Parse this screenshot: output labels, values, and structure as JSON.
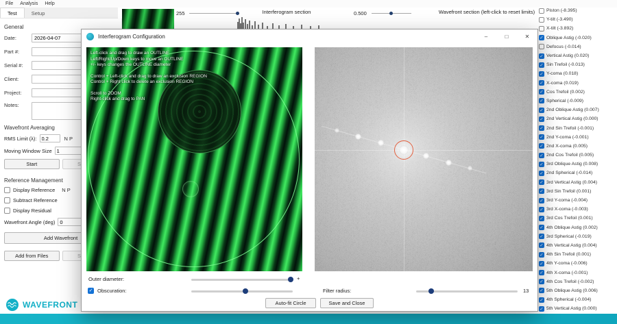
{
  "menu": {
    "items": [
      "File",
      "Analysis",
      "Help"
    ]
  },
  "tabs": [
    {
      "label": "Test"
    },
    {
      "label": "Setup"
    }
  ],
  "general": {
    "title": "General",
    "fields": [
      {
        "label": "Date:",
        "value": "2026-04-07"
      },
      {
        "label": "Part #:",
        "value": ""
      },
      {
        "label": "Serial #:",
        "value": ""
      },
      {
        "label": "Client:",
        "value": ""
      },
      {
        "label": "Project:",
        "value": ""
      },
      {
        "label": "Notes:",
        "value": "",
        "tall": true
      }
    ]
  },
  "averaging": {
    "title": "Wavefront Averaging",
    "rms_label": "RMS Limit (λ):",
    "rms_value": "0.2",
    "rms_suffix": "N P",
    "window_label": "Moving Window Size",
    "window_value": "1",
    "start_button": "Start",
    "save_button": "Save to Fil"
  },
  "reference": {
    "title": "Reference Management",
    "checkboxes": [
      {
        "label": "Display Reference",
        "checked": false,
        "suffix": "N P"
      },
      {
        "label": "Subtract Reference",
        "checked": false
      },
      {
        "label": "Display Residual",
        "checked": false
      }
    ],
    "angle_label": "Wavefront Angle (deg)",
    "angle_value": "0",
    "add_wavefront_button": "Add Wavefront",
    "add_from_files_button": "Add from Files",
    "save_button": "Save to Fil"
  },
  "sections_bar": {
    "interferogram_level": "255",
    "interferogram_title": "Interferogram section",
    "wavefront_level": "0.500",
    "wavefront_title": "Wavefront section (left-click to reset limits)"
  },
  "brand": {
    "name": "WAVEFRONT",
    "accent": "#13b0c7"
  },
  "zernike": {
    "items": [
      {
        "label": "Piston (-8.395)",
        "checked": false
      },
      {
        "label": "Y-tilt (-3.490)",
        "checked": false
      },
      {
        "label": "X-tilt (-3.892)",
        "checked": false
      },
      {
        "label": "Oblique Astig (-0.020)",
        "checked": true
      },
      {
        "label": "Defocus (-0.014)",
        "checked": false
      },
      {
        "label": "Vertical Astig (0.020)",
        "checked": true
      },
      {
        "label": "Sin Trefoil (-0.013)",
        "checked": true
      },
      {
        "label": "Y-coma (0.018)",
        "checked": true
      },
      {
        "label": "X-coma (0.019)",
        "checked": true
      },
      {
        "label": "Cos Trefoil (0.002)",
        "checked": true
      },
      {
        "label": "Spherical (-0.009)",
        "checked": true
      },
      {
        "label": "2nd Oblique Astig (0.007)",
        "checked": true
      },
      {
        "label": "2nd Vertical Astig (0.000)",
        "checked": true
      },
      {
        "label": "2nd Sin Trefoil (-0.001)",
        "checked": true
      },
      {
        "label": "2nd Y-coma (-0.001)",
        "checked": true
      },
      {
        "label": "2nd X-coma (0.005)",
        "checked": true
      },
      {
        "label": "2nd Cos Trefoil (0.005)",
        "checked": true
      },
      {
        "label": "3rd Oblique Astig (0.008)",
        "checked": true
      },
      {
        "label": "2nd Spherical (-0.014)",
        "checked": true
      },
      {
        "label": "3rd Vertical Astig (0.004)",
        "checked": true
      },
      {
        "label": "3rd Sin Trefoil (0.001)",
        "checked": true
      },
      {
        "label": "3rd Y-coma (-0.004)",
        "checked": true
      },
      {
        "label": "3rd X-coma (-0.003)",
        "checked": true
      },
      {
        "label": "3rd Cos Trefoil (0.001)",
        "checked": true
      },
      {
        "label": "4th Oblique Astig (0.002)",
        "checked": true
      },
      {
        "label": "3rd Spherical (-0.019)",
        "checked": true
      },
      {
        "label": "4th Vertical Astig (0.004)",
        "checked": true
      },
      {
        "label": "4th Sin Trefoil (0.001)",
        "checked": true
      },
      {
        "label": "4th Y-coma (-0.006)",
        "checked": true
      },
      {
        "label": "4th X-coma (-0.001)",
        "checked": true
      },
      {
        "label": "4th Cos Trefoil (-0.002)",
        "checked": true
      },
      {
        "label": "5th Oblique Astig (0.006)",
        "checked": true
      },
      {
        "label": "4th Spherical (-0.004)",
        "checked": true
      },
      {
        "label": "5th Vertical Astig (0.000)",
        "checked": true
      }
    ]
  },
  "modal": {
    "title": "Interferogram Configuration",
    "window_buttons": {
      "minimize": "–",
      "maximize": "□",
      "close": "✕"
    },
    "instructions": [
      "Left-click and drag to draw an OUTLINE",
      "Left/Right/Up/Down keys to move an OUTLINE",
      "+/- keys changes the OUTLINE diameter",
      "",
      "Control + Left-click and drag to draw an exclusion REGION",
      "Control + Right click to delete an exclusion REGION",
      "",
      "Scroll to ZOOM",
      "Right-click and drag to PAN"
    ],
    "controls": {
      "outer_diameter_label": "Outer diameter:",
      "outer_plus": "+",
      "obscuration_label": "Obscuration:",
      "obscuration_checked": true,
      "filter_radius_label": "Filter radius:",
      "filter_radius_value": "13",
      "autofit_button": "Auto-fit Circle",
      "save_close_button": "Save and Close"
    }
  }
}
